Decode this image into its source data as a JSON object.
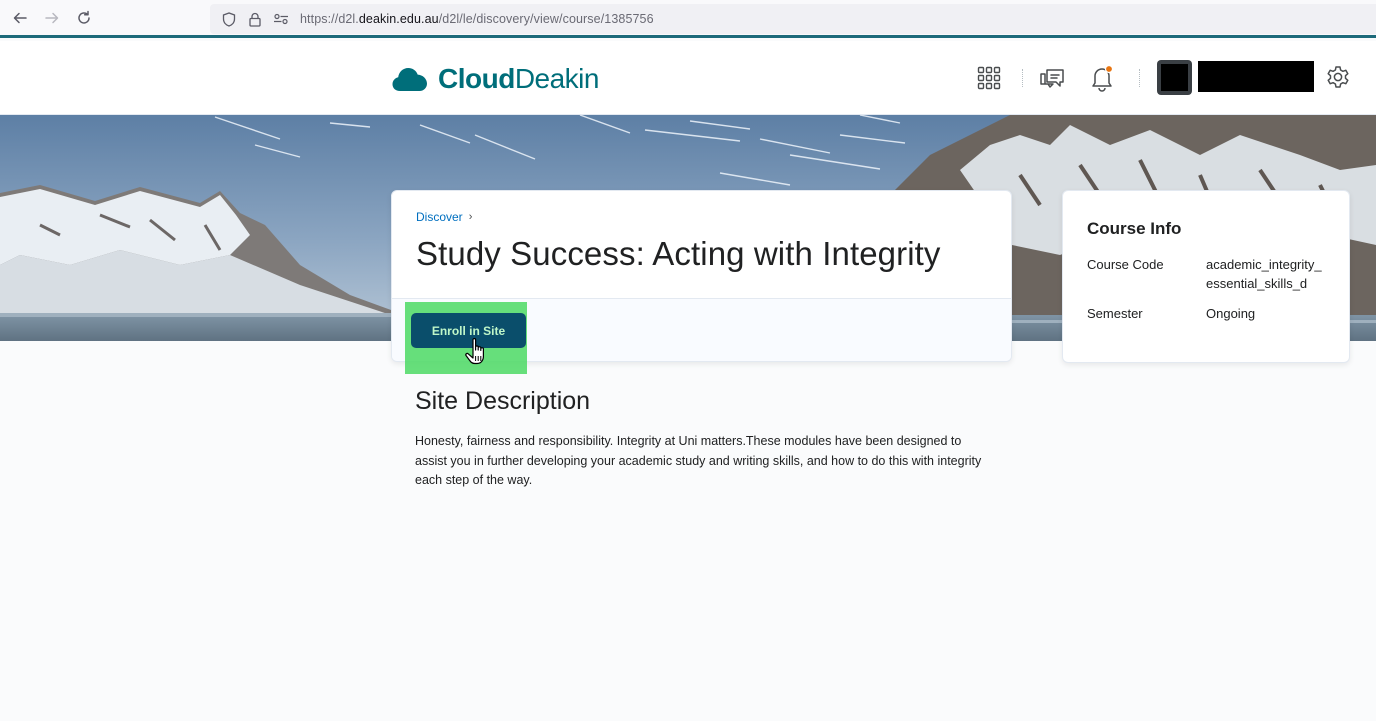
{
  "browser": {
    "url_prefix": "https://d2l.",
    "url_host": "deakin.edu.au",
    "url_path": "/d2l/le/discovery/view/course/1385756"
  },
  "header": {
    "logo_bold": "Cloud",
    "logo_light": "Deakin",
    "brand_color": "#006e7a",
    "icons": [
      "apps-grid-icon",
      "messages-icon",
      "notifications-bell-icon",
      "settings-gear-icon"
    ]
  },
  "course": {
    "breadcrumb": "Discover",
    "title": "Study Success: Acting with Integrity",
    "enroll_label": "Enroll in Site"
  },
  "course_info": {
    "heading": "Course Info",
    "code_label": "Course Code",
    "code_value": "academic_integrity_ essential_skills_d",
    "semester_label": "Semester",
    "semester_value": "Ongoing"
  },
  "description": {
    "heading": "Site Description",
    "text": "Honesty, fairness and responsibility. Integrity at Uni matters.These modules have been designed to assist you in further developing your academic study and writing skills, and how to do this with integrity each step of the way."
  }
}
